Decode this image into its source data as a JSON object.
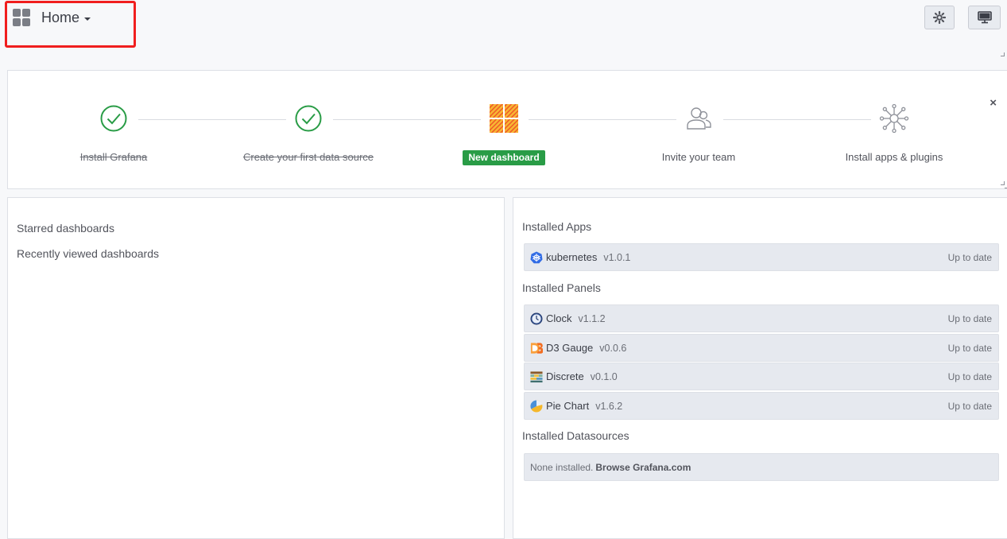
{
  "navbar": {
    "dashboard_title": "Home",
    "settings_icon": "gear-icon",
    "tv_icon": "monitor-icon"
  },
  "progress": {
    "steps": [
      {
        "label": "Install Grafana",
        "state": "done",
        "icon": "check-circle-icon"
      },
      {
        "label": "Create your first data source",
        "state": "done",
        "icon": "check-circle-icon"
      },
      {
        "label": "New dashboard",
        "state": "active",
        "icon": "dashboard-grid-icon"
      },
      {
        "label": "Invite your team",
        "state": "todo",
        "icon": "users-icon"
      },
      {
        "label": "Install apps & plugins",
        "state": "todo",
        "icon": "plugin-network-icon"
      }
    ],
    "close": "×"
  },
  "dashboards": {
    "starred": "Starred dashboards",
    "recent": "Recently viewed dashboards"
  },
  "plugins": {
    "apps_title": "Installed Apps",
    "apps": [
      {
        "name": "kubernetes",
        "version": "v1.0.1",
        "status": "Up to date",
        "icon": "kubernetes-icon"
      }
    ],
    "panels_title": "Installed Panels",
    "panels": [
      {
        "name": "Clock",
        "version": "v1.1.2",
        "status": "Up to date",
        "icon": "clock-icon"
      },
      {
        "name": "D3 Gauge",
        "version": "v0.0.6",
        "status": "Up to date",
        "icon": "d3-icon"
      },
      {
        "name": "Discrete",
        "version": "v0.1.0",
        "status": "Up to date",
        "icon": "discrete-icon"
      },
      {
        "name": "Pie Chart",
        "version": "v1.6.2",
        "status": "Up to date",
        "icon": "pie-chart-icon"
      }
    ],
    "datasources_title": "Installed Datasources",
    "datasources_none": "None installed.",
    "datasources_link": "Browse Grafana.com"
  },
  "colors": {
    "success": "#299c46",
    "highlight": "#f01e1e",
    "accent": "#f5a623"
  }
}
